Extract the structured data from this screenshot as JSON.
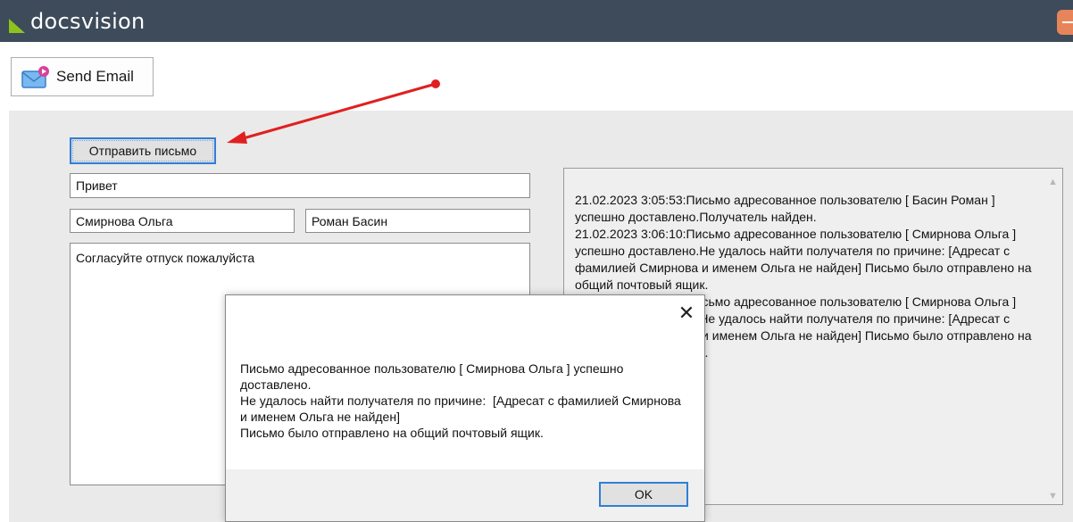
{
  "app": {
    "brand": "docsvision"
  },
  "toolbar": {
    "send_email_label": "Send Email"
  },
  "form": {
    "send_button_label": "Отправить письмо",
    "subject_value": "Привет",
    "recipient_value": "Смирнова Ольга",
    "sender_value": "Роман Басин",
    "body_value": "Согласуйте отпуск пожалуйста"
  },
  "log": {
    "lines": [
      "21.02.2023 3:05:53:Письмо адресованное пользователю [ Басин Роман ] успешно доставлено.Получатель найден.",
      "21.02.2023 3:06:10:Письмо адресованное пользователю [ Смирнова Ольга ] успешно доставлено.Не удалось найти получателя по причине:  [Адресат с фамилией Смирнова и именем Ольга не найден] Письмо было отправлено на общий почтовый ящик.",
      "21.02.2023 3:06:12:Письмо адресованное пользователю [ Смирнова Ольга ] успешно доставлено.Не удалось найти получателя по причине:  [Адресат с фамилией Смирнова и именем Ольга не найден] Письмо было отправлено на общий почтовый ящик."
    ]
  },
  "dialog": {
    "message_lines": [
      "Письмо адресованное пользователю [ Смирнова Ольга ] успешно доставлено.",
      "Не удалось найти получателя по причине:  [Адресат с фамилией Смирнова и именем Ольга не найден]",
      "Письмо было отправлено на общий почтовый ящик."
    ],
    "ok_label": "OK",
    "close_glyph": "✕"
  },
  "colors": {
    "topbar": "#3d4b5a",
    "brand_accent": "#8dc21f",
    "focus_border": "#2f7fd5",
    "annotation_arrow": "#e02020"
  },
  "icons": {
    "email": "email-envelope-icon",
    "close": "close-icon",
    "scroll_up": "scroll-up-icon",
    "scroll_down": "scroll-down-icon"
  }
}
